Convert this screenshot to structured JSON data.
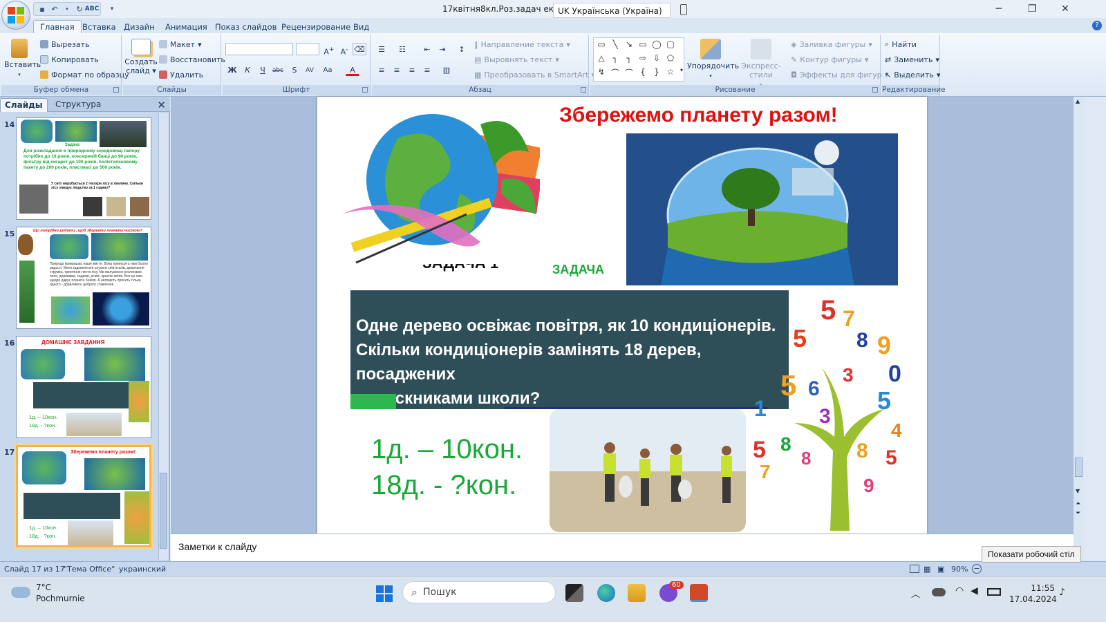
{
  "window": {
    "title": "17квітня8кл.Роз.задач екол.",
    "language_indicator": "UK Українська (Україна)"
  },
  "ribbon_tabs": [
    "Главная",
    "Вставка",
    "Дизайн",
    "Анимация",
    "Показ слайдов",
    "Рецензирование",
    "Вид"
  ],
  "ribbon": {
    "clipboard": {
      "title": "Буфер обмена",
      "paste": "Вставить",
      "cut": "Вырезать",
      "copy": "Копировать",
      "format_painter": "Формат по образцу"
    },
    "slides": {
      "title": "Слайды",
      "new_slide_line1": "Создать",
      "new_slide_line2": "слайд",
      "layout": "Макет",
      "reset": "Восстановить",
      "delete": "Удалить"
    },
    "font": {
      "title": "Шрифт"
    },
    "paragraph": {
      "title": "Абзац",
      "text_direction": "Направление текста",
      "align_text": "Выровнять текст",
      "smartart": "Преобразовать в SmartArt"
    },
    "drawing": {
      "title": "Рисование",
      "arrange": "Упорядочить",
      "quick_styles": "Экспресс-стили",
      "shape_fill": "Заливка фигуры",
      "shape_outline": "Контур фигуры",
      "shape_effects": "Эффекты для фигур"
    },
    "editing": {
      "title": "Редактирование",
      "find": "Найти",
      "replace": "Заменить",
      "select": "Выделить"
    }
  },
  "left_pane": {
    "tab_slides": "Слайды",
    "tab_outline": "Структура",
    "thumbnails": [
      {
        "number": "14",
        "heading": "Задача",
        "text": "Для розкладання в природному середовищі паперу потрібно до 10 років, консервній банці до 90 років, фільтру від сигарет до 100 років, поліетиленовому пакету до 200 років, пластмасі до 500 років.",
        "text2": "У світі вирубується 2 гектари лісу в хвилину. Скільки лісу знищує людство за 1 годину?"
      },
      {
        "number": "15",
        "heading": "Що потрібно робити , щоб зберегти планету чистою?",
        "text": "Природа прикрашає наше життя. Вона приносить нам багато радості. Мати задоволення слухати спів птахів, дзюрчання струмка, тріпотіння листя лісу. Ми милуємося рослинами поля, деревами, садами, річки і красою квітів. Все це нам щедро дарує планета Земля. А натомість просить тільки одного - дбайливого доброго ставлення."
      },
      {
        "number": "16",
        "heading": "ДОМАШНЄ ЗАВДАННЯ",
        "formula1": "1д. – 10кон.",
        "formula2": "18д. - ?кон."
      },
      {
        "number": "17",
        "heading": "Збережемо планету разом!",
        "formula1": "1д. – 10кон.",
        "formula2": "18д. - ?кон."
      }
    ]
  },
  "slide": {
    "title": "Збережемо планету  разом!",
    "partial_label": "ЗАДАЧА 1",
    "zadacha_label": "ЗАДАЧА",
    "task_lines": [
      "Одне дерево освіжає повітря, як 10 кондиціонерів.",
      "Скільки кондиціонерів замінять 18 дерев, посаджених",
      "випускниками школи?"
    ],
    "formula1": "1д. – 10кон.",
    "formula2": "18д. - ?кон."
  },
  "notes_placeholder": "Заметки к слайду",
  "status": {
    "slide_counter": "Слайд 17 из 17",
    "theme": "\"Тема Office\"",
    "language": "украинский",
    "zoom": "90%"
  },
  "tooltip": "Показати робочий стіл",
  "taskbar": {
    "temperature": "7°C",
    "weather_desc": "Pochmurnie",
    "search_placeholder": "Пошук",
    "viber_badge": "60",
    "time": "11:55",
    "date": "17.04.2024"
  },
  "colors": {
    "title_red": "#e01010",
    "accent_green": "#18a838",
    "task_box": "#2f4f58",
    "selected_thumb": "#f6b54a"
  }
}
